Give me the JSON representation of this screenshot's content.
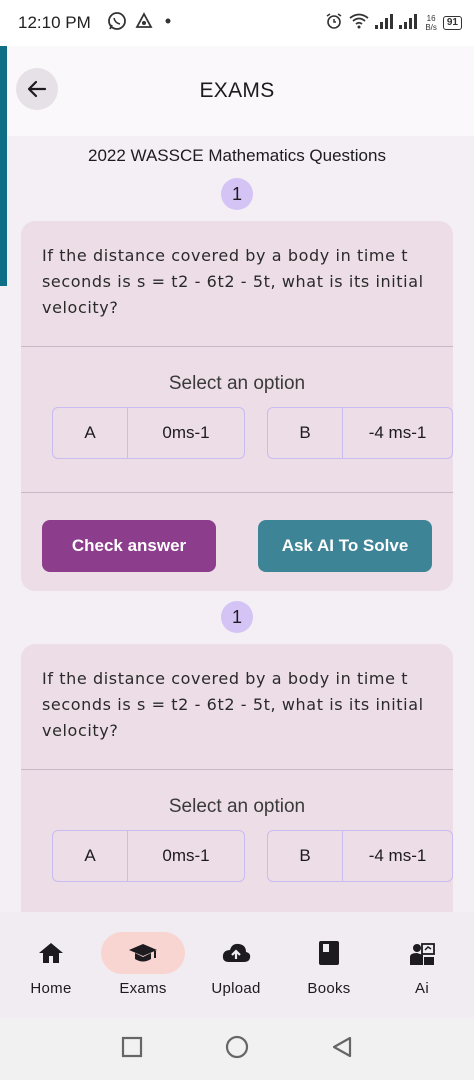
{
  "status_bar": {
    "time": "12:10 PM",
    "net_speed_value": "16",
    "net_speed_unit": "B/s",
    "battery": "91"
  },
  "app_bar": {
    "title": "EXAMS"
  },
  "exam": {
    "subtitle": "2022 WASSCE Mathematics Questions"
  },
  "questions": [
    {
      "number": "1",
      "text": "If the distance covered by a body in time t seconds is s = t2 - 6t2  - 5t, what is its initial velocity?",
      "select_label": "Select an option",
      "options": [
        {
          "letter": "A",
          "text": "0ms-1"
        },
        {
          "letter": "B",
          "text": "-4 ms-1"
        }
      ],
      "check_label": "Check answer",
      "ai_label": "Ask AI To Solve"
    },
    {
      "number": "1",
      "text": "If the distance covered by a body in time t seconds is s = t2 - 6t2  - 5t, what is its initial velocity?",
      "select_label": "Select an option",
      "options": [
        {
          "letter": "A",
          "text": "0ms-1"
        },
        {
          "letter": "B",
          "text": "-4 ms-1"
        }
      ]
    }
  ],
  "bottom_nav": [
    {
      "label": "Home",
      "icon": "home-icon"
    },
    {
      "label": "Exams",
      "icon": "graduation-cap-icon",
      "active": true
    },
    {
      "label": "Upload",
      "icon": "cloud-upload-icon"
    },
    {
      "label": "Books",
      "icon": "book-icon"
    },
    {
      "label": "Ai",
      "icon": "ai-teacher-icon"
    }
  ],
  "colors": {
    "accent_purple": "#8c3d8c",
    "accent_teal": "#3e8497",
    "number_badge": "#d4c4f5",
    "active_pill": "#f8d5d0"
  }
}
